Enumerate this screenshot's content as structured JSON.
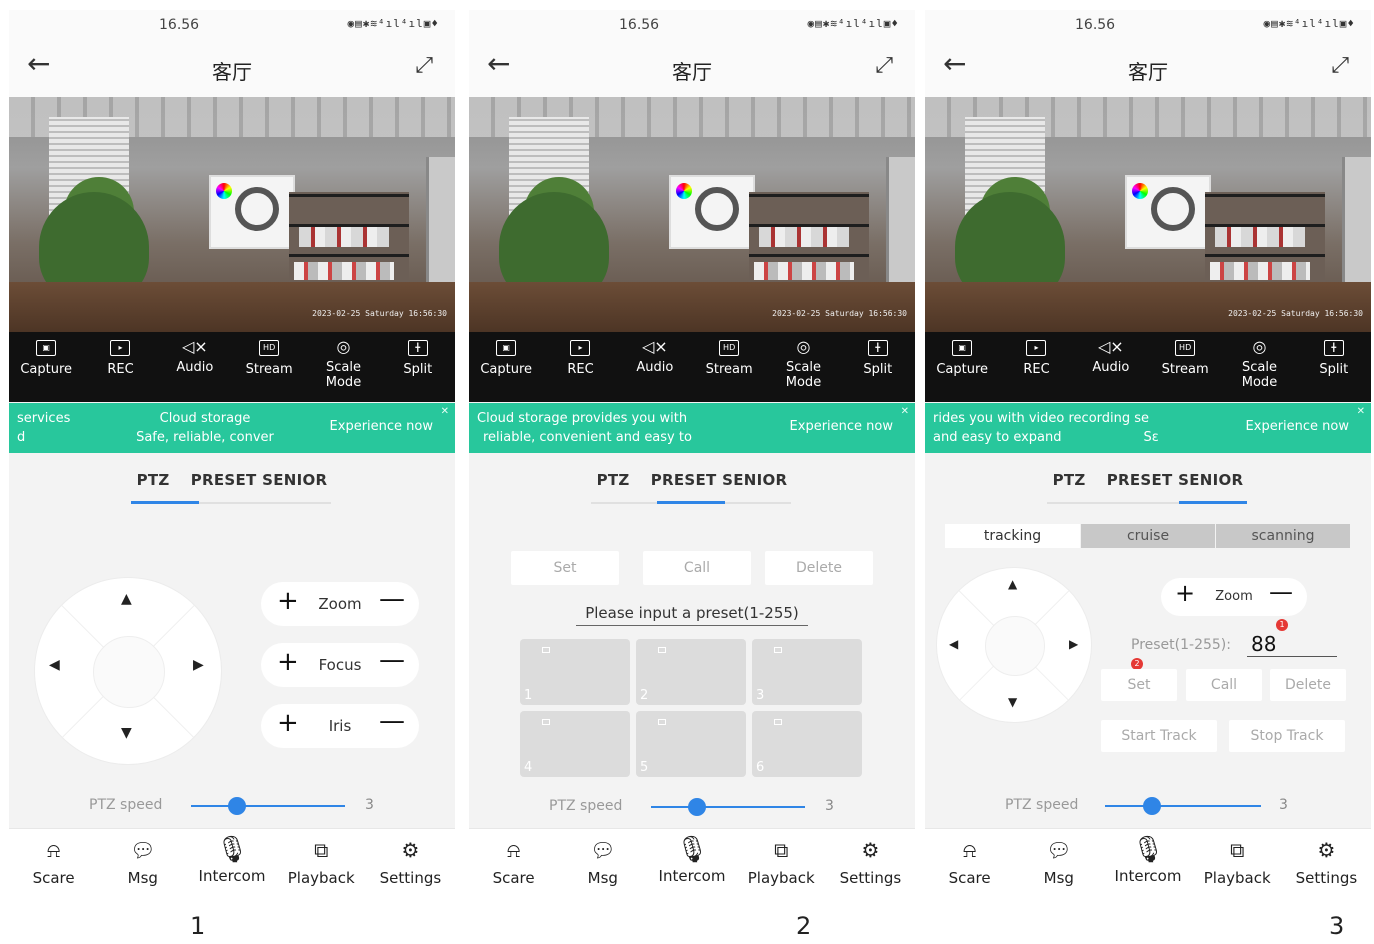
{
  "status_time": "16.56",
  "status_icons": "◉▤✱≋⁴ıl⁴ıl▣♦",
  "title": "客厅",
  "toolbar": {
    "capture": "Capture",
    "rec": "REC",
    "audio": "Audio",
    "stream": "Stream",
    "stream_icon": "HD",
    "scale_mode": "Scale\nMode",
    "split": "Split"
  },
  "camera_timestamp": "2023-02-25 Saturday 16:56:30",
  "banner": {
    "experience": "Experience now",
    "p1_line1": "services",
    "p1_line2": "d",
    "p1_center1": "Cloud storage",
    "p1_center2": "Safe, reliable, conver",
    "p2_line1": "Cloud storage provides you with",
    "p2_line2": "reliable, convenient and easy to",
    "p3_line1": "rides you with video recording se",
    "p3_line2": "and easy to expand",
    "p3_line2b": "Sε"
  },
  "tabs": {
    "ptz": "PTZ",
    "preset_senior": "PRESET SENIOR"
  },
  "controls": {
    "zoom": "Zoom",
    "focus": "Focus",
    "iris": "Iris",
    "plus": "+",
    "minus": "—"
  },
  "ptz_speed": {
    "label": "PTZ speed",
    "value": "3",
    "max": 10
  },
  "nav": {
    "scare": "Scare",
    "msg": "Msg",
    "intercom": "Intercom",
    "playback": "Playback",
    "settings": "Settings"
  },
  "preset": {
    "set": "Set",
    "call": "Call",
    "delete": "Delete",
    "prompt": "Please input a preset(1-255)",
    "slots": [
      "1",
      "2",
      "3",
      "4",
      "5",
      "6"
    ]
  },
  "senior": {
    "modes": [
      "tracking",
      "cruise",
      "scanning"
    ],
    "zoom": "Zoom",
    "preset_label": "Preset(1-255):",
    "preset_value": "88",
    "badge1": "1",
    "badge2": "2",
    "set": "Set",
    "call": "Call",
    "delete": "Delete",
    "start_track": "Start Track",
    "stop_track": "Stop Track"
  },
  "captions": [
    "1",
    "2",
    "3"
  ],
  "colors": {
    "accent": "#2f85e6",
    "banner": "#28c79c",
    "toolbar": "#111111"
  }
}
